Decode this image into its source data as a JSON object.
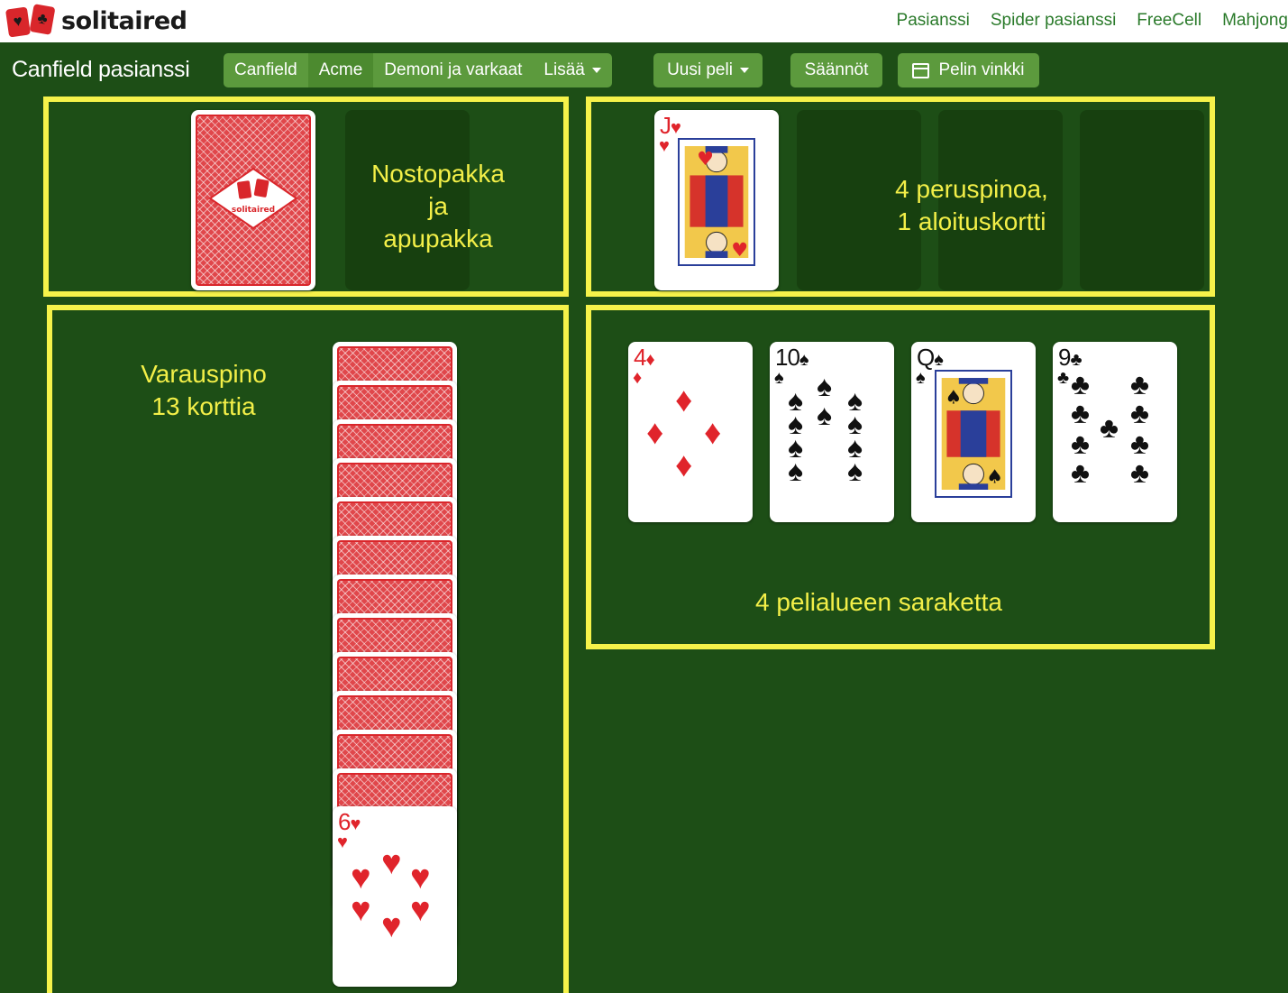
{
  "brand": {
    "name": "solitaired"
  },
  "top_nav": [
    "Pasianssi",
    "Spider pasianssi",
    "FreeCell",
    "Mahjong"
  ],
  "page_title": "Canfield pasianssi",
  "variant_tabs": [
    "Canfield",
    "Acme",
    "Demoni ja varkaat"
  ],
  "more_menu": "Lisää",
  "new_game": "Uusi peli",
  "rules": "Säännöt",
  "hint": "Pelin vinkki",
  "colors": {
    "felt": "#1d4e16",
    "button": "#5c9a3d",
    "highlight": "#f5f24a",
    "card_red": "#e0242b"
  },
  "zones": {
    "stock": {
      "label_lines": [
        "Nostopakka",
        "ja",
        "apupakka"
      ],
      "back_logo": "solitaired"
    },
    "foundation": {
      "label_lines": [
        "4 peruspinoa,",
        "1 aloituskortti"
      ],
      "card": {
        "rank": "J",
        "suit": "♥"
      }
    },
    "reserve": {
      "label_lines": [
        "Varauspino",
        "13 korttia"
      ],
      "face_down_count": 12,
      "top_card": {
        "rank": "6",
        "suit": "♥"
      }
    },
    "tableau": {
      "label": "4 pelialueen saraketta",
      "cards": [
        {
          "rank": "4",
          "suit": "♦"
        },
        {
          "rank": "10",
          "suit": "♠"
        },
        {
          "rank": "Q",
          "suit": "♠"
        },
        {
          "rank": "9",
          "suit": "♣"
        }
      ]
    }
  }
}
